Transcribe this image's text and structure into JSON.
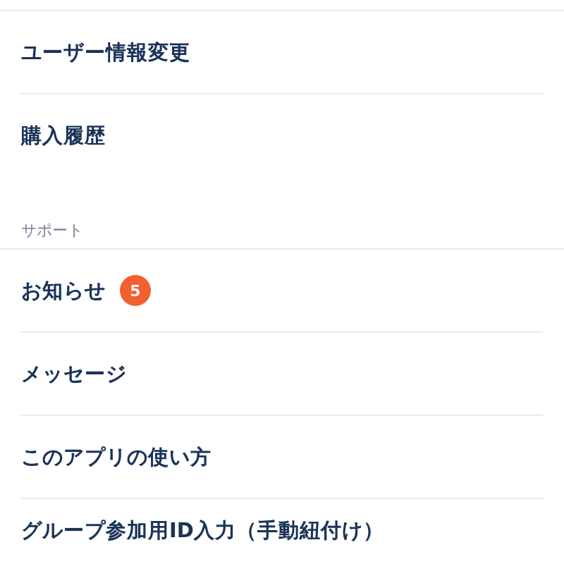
{
  "sections": [
    {
      "items": [
        {
          "label": "ユーザー情報変更"
        },
        {
          "label": "購入履歴"
        }
      ]
    },
    {
      "title": "サポート",
      "items": [
        {
          "label": "お知らせ",
          "badge": "5"
        },
        {
          "label": "メッセージ"
        },
        {
          "label": "このアプリの使い方"
        },
        {
          "label": "グループ参加用ID入力（手動紐付け）"
        }
      ]
    }
  ]
}
